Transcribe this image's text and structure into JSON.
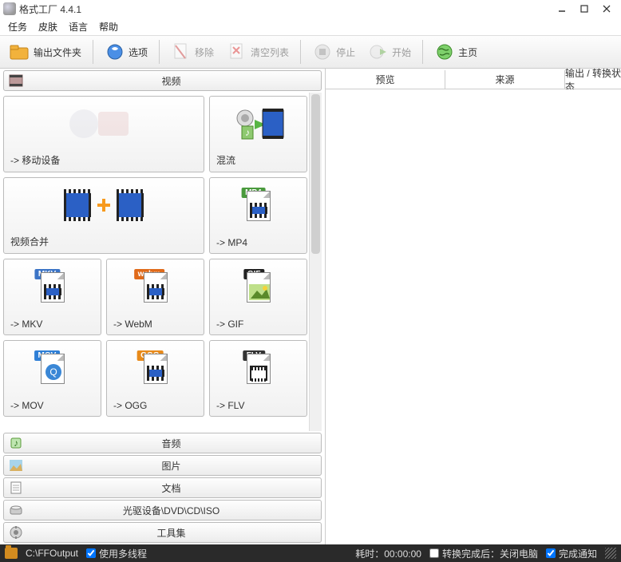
{
  "window": {
    "title": "格式工厂 4.4.1"
  },
  "menu": {
    "task": "任务",
    "skin": "皮肤",
    "language": "语言",
    "help": "帮助"
  },
  "toolbar": {
    "output_folder": "输出文件夹",
    "options": "选项",
    "remove": "移除",
    "clear_list": "清空列表",
    "stop": "停止",
    "start": "开始",
    "home": "主页"
  },
  "categories": {
    "video": "视频",
    "audio": "音频",
    "image": "图片",
    "document": "文档",
    "optical": "光驱设备\\DVD\\CD\\ISO",
    "tools": "工具集"
  },
  "tiles": {
    "mobile": "-> 移动设备",
    "mux": "混流",
    "video_join": "视频合并",
    "mp4": "-> MP4",
    "mkv": "-> MKV",
    "webm": "-> WebM",
    "gif": "-> GIF",
    "mov": "-> MOV",
    "ogg": "-> OGG",
    "flv": "-> FLV"
  },
  "badges": {
    "mp4": "MP4",
    "mkv": "MKV",
    "webm": "webm",
    "gif": "GIF",
    "mov": "MOV",
    "ogg": "OGG",
    "flv": "FLV"
  },
  "right_columns": {
    "preview": "预览",
    "source": "来源",
    "status": "输出 / 转换状态"
  },
  "status": {
    "output_path": "C:\\FFOutput",
    "multithread": "使用多线程",
    "elapsed_label": "耗时：",
    "elapsed_value": "00:00:00",
    "after_label": "转换完成后：",
    "after_value": "关闭电脑",
    "notify": "完成通知"
  },
  "checks": {
    "multithread": true,
    "after": false,
    "notify": true
  }
}
